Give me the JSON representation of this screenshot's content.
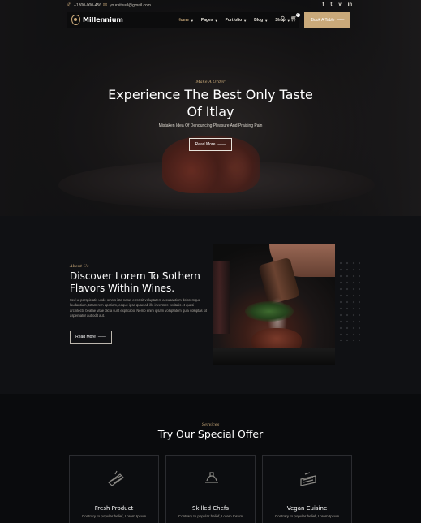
{
  "topbar": {
    "phone": "+1800-000-456",
    "email": "yoursiteurl@gmail.com",
    "social": [
      "f",
      "t",
      "v",
      "in"
    ]
  },
  "brand": {
    "name": "Millennium",
    "logo_icon": "location-pin-logo"
  },
  "nav": {
    "items": [
      {
        "label": "Home",
        "active": true
      },
      {
        "label": "Pages"
      },
      {
        "label": "Portfolio"
      },
      {
        "label": "Blog"
      },
      {
        "label": "Shop"
      }
    ],
    "cart_count": "0",
    "book_label": "Book A Table"
  },
  "hero": {
    "subtitle": "Make A Order",
    "title": "Experience The Best Only Taste Of Itlay",
    "description": "Mistaken Idea Of Denouncing Pleasure And Praising Pain",
    "button": "Read More"
  },
  "about": {
    "subtitle": "About Us",
    "title": "Discover Lorem To Sothern Flavors Within Wines.",
    "text": "Sed ut perspiciatis unde omnis iste natus error sit voluptatem accusantium doloremque laudantium, totam rem aperiam, eaque ipsa quae ab illo inventore veritatis et quasi architecto beatae vitae dicta sunt explicabo. Nemo enim ipsam voluptatem quia voluptas sit aspernatur aut odit aut.",
    "button": "Read More"
  },
  "offer": {
    "subtitle": "Services",
    "title": "Try Our Special Offer",
    "cards": [
      {
        "title": "Fresh Product",
        "text": "Contrary to popular belief, Lorem Ipsum",
        "icon": "grill-icon"
      },
      {
        "title": "Skilled Chefs",
        "text": "Contrary to popular belief, Lorem Ipsum",
        "icon": "chef-knife-icon"
      },
      {
        "title": "Vegan Cuisine",
        "text": "Contrary to popular belief, Lorem Ipsum",
        "icon": "dish-icon"
      }
    ]
  },
  "colors": {
    "accent": "#c9a97a",
    "background": "#0e0f12"
  }
}
